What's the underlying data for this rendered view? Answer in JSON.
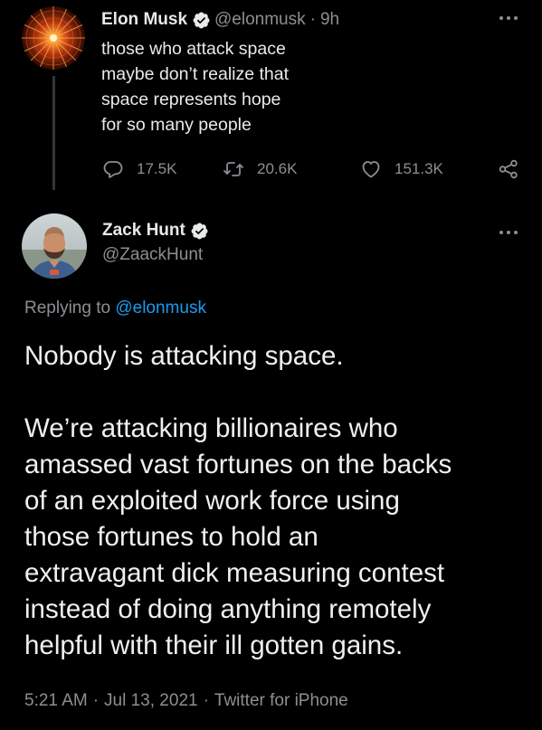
{
  "original_tweet": {
    "author_name": "Elon Musk",
    "handle": "@elonmusk",
    "separator": "·",
    "time": "9h",
    "text_lines": [
      "those who attack space",
      "maybe don’t realize that",
      "space represents hope",
      "for so many people"
    ],
    "reply_count": "17.5K",
    "retweet_count": "20.6K",
    "like_count": "151.3K"
  },
  "reply_tweet": {
    "author_name": "Zack Hunt",
    "handle": "@ZaackHunt",
    "replying_prefix": "Replying to",
    "replying_mention": "@elonmusk",
    "paragraph1": [
      "Nobody is attacking space."
    ],
    "paragraph2": [
      "We’re attacking billionaires who",
      "amassed vast fortunes on the backs",
      "of an exploited work force using",
      "those fortunes to hold an",
      "extravagant dick measuring contest",
      "instead of doing anything remotely",
      "helpful with their ill gotten gains."
    ],
    "timestamp": "5:21 AM",
    "date": "Jul 13, 2021",
    "separator": "·",
    "source": "Twitter for iPhone"
  },
  "colors": {
    "background": "#000000",
    "text": "#e7e9ea",
    "secondary": "#8b8f93",
    "link": "#1d9bf0"
  },
  "icons": {
    "verified": "verified-badge-icon",
    "reply": "reply-icon",
    "retweet": "retweet-icon",
    "like": "heart-icon",
    "share": "share-icon",
    "more": "more-options-icon"
  }
}
